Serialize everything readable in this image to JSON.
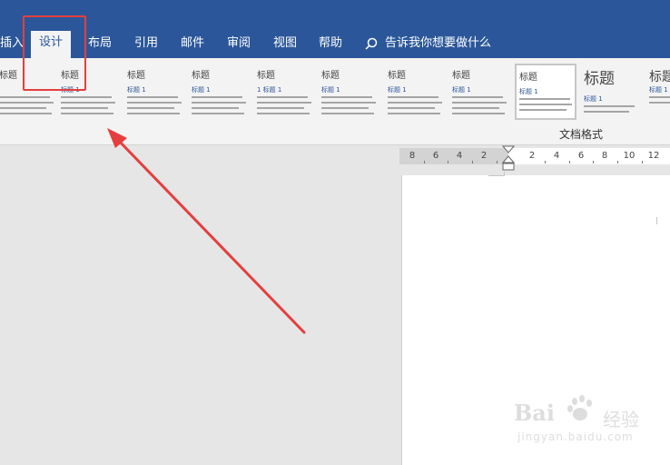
{
  "tabs": [
    {
      "label": "插入",
      "active": false
    },
    {
      "label": "设计",
      "active": true
    },
    {
      "label": "布局",
      "active": false
    },
    {
      "label": "引用",
      "active": false
    },
    {
      "label": "邮件",
      "active": false
    },
    {
      "label": "审阅",
      "active": false
    },
    {
      "label": "视图",
      "active": false
    },
    {
      "label": "帮助",
      "active": false
    }
  ],
  "tell_me": {
    "icon": "search-icon",
    "label": "告诉我你想要做什么"
  },
  "ribbon": {
    "group_label": "文档格式",
    "style_thumbnails": [
      {
        "title": "标题",
        "heading": "",
        "selected": false
      },
      {
        "title": "标题",
        "heading": "标题 1",
        "selected": false
      },
      {
        "title": "标题",
        "heading": "标题 1",
        "selected": false
      },
      {
        "title": "标题",
        "heading": "标题 1",
        "selected": false
      },
      {
        "title": "标题",
        "heading": "1 标题 1",
        "selected": false
      },
      {
        "title": "标题",
        "heading": "标题 1",
        "selected": false
      },
      {
        "title": "标题",
        "heading": "标题 1",
        "selected": false
      },
      {
        "title": "标题",
        "heading": "标题 1",
        "selected": false
      },
      {
        "title": "标题",
        "heading": "标题 1",
        "selected": true
      },
      {
        "title": "标题",
        "heading": "标题 1",
        "selected": false
      },
      {
        "title": "标题",
        "heading": "标题 1",
        "selected": false
      }
    ]
  },
  "ruler": {
    "labels": [
      "8",
      "6",
      "4",
      "2",
      "2",
      "4",
      "6",
      "8",
      "10",
      "12"
    ]
  },
  "annotation": {
    "highlight_color": "#e53e3e",
    "arrow_color": "#e53e3e"
  },
  "watermark": {
    "brand": "Bai",
    "product": "经验",
    "url": "jingyan.baidu.com"
  },
  "colors": {
    "ribbon_tabs_bg": "#2b579a",
    "ribbon_bg": "#f3f3f3",
    "canvas_bg": "#e6e6e6"
  }
}
